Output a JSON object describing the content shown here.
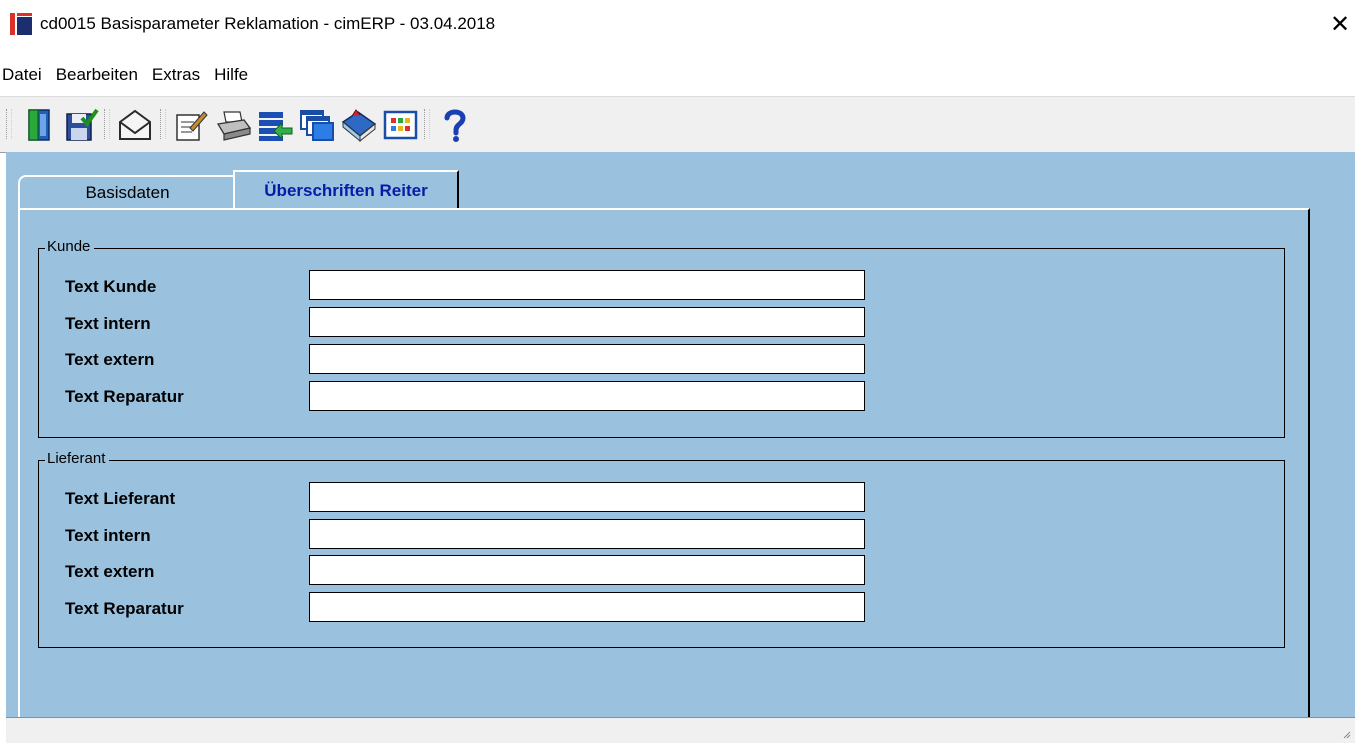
{
  "window": {
    "title": "cd0015 Basisparameter Reklamation - cimERP - 03.04.2018",
    "close_label": "✕"
  },
  "menu": {
    "items": [
      "Datei",
      "Bearbeiten",
      "Extras",
      "Hilfe"
    ]
  },
  "toolbar": {
    "buttons": [
      "exit-icon",
      "save-icon",
      "mail-icon",
      "edit-icon",
      "print-icon",
      "list-icon",
      "windows-icon",
      "book-icon",
      "grid-icon",
      "help-icon"
    ]
  },
  "tabs": {
    "basisdaten": "Basisdaten",
    "ueberschriften": "Überschriften Reiter",
    "active": "Überschriften Reiter"
  },
  "kunde": {
    "legend": "Kunde",
    "fields": [
      {
        "label": "Text Kunde",
        "value": ""
      },
      {
        "label": "Text intern",
        "value": ""
      },
      {
        "label": "Text extern",
        "value": ""
      },
      {
        "label": "Text Reparatur",
        "value": ""
      }
    ]
  },
  "lieferant": {
    "legend": "Lieferant",
    "fields": [
      {
        "label": "Text Lieferant",
        "value": ""
      },
      {
        "label": "Text intern",
        "value": ""
      },
      {
        "label": "Text extern",
        "value": ""
      },
      {
        "label": "Text Reparatur",
        "value": ""
      }
    ]
  },
  "colors": {
    "panel_background": "#9ac2df",
    "active_tab_text": "#0a1aa8",
    "logo_red": "#d9322a",
    "logo_blue": "#1b2e6d"
  }
}
